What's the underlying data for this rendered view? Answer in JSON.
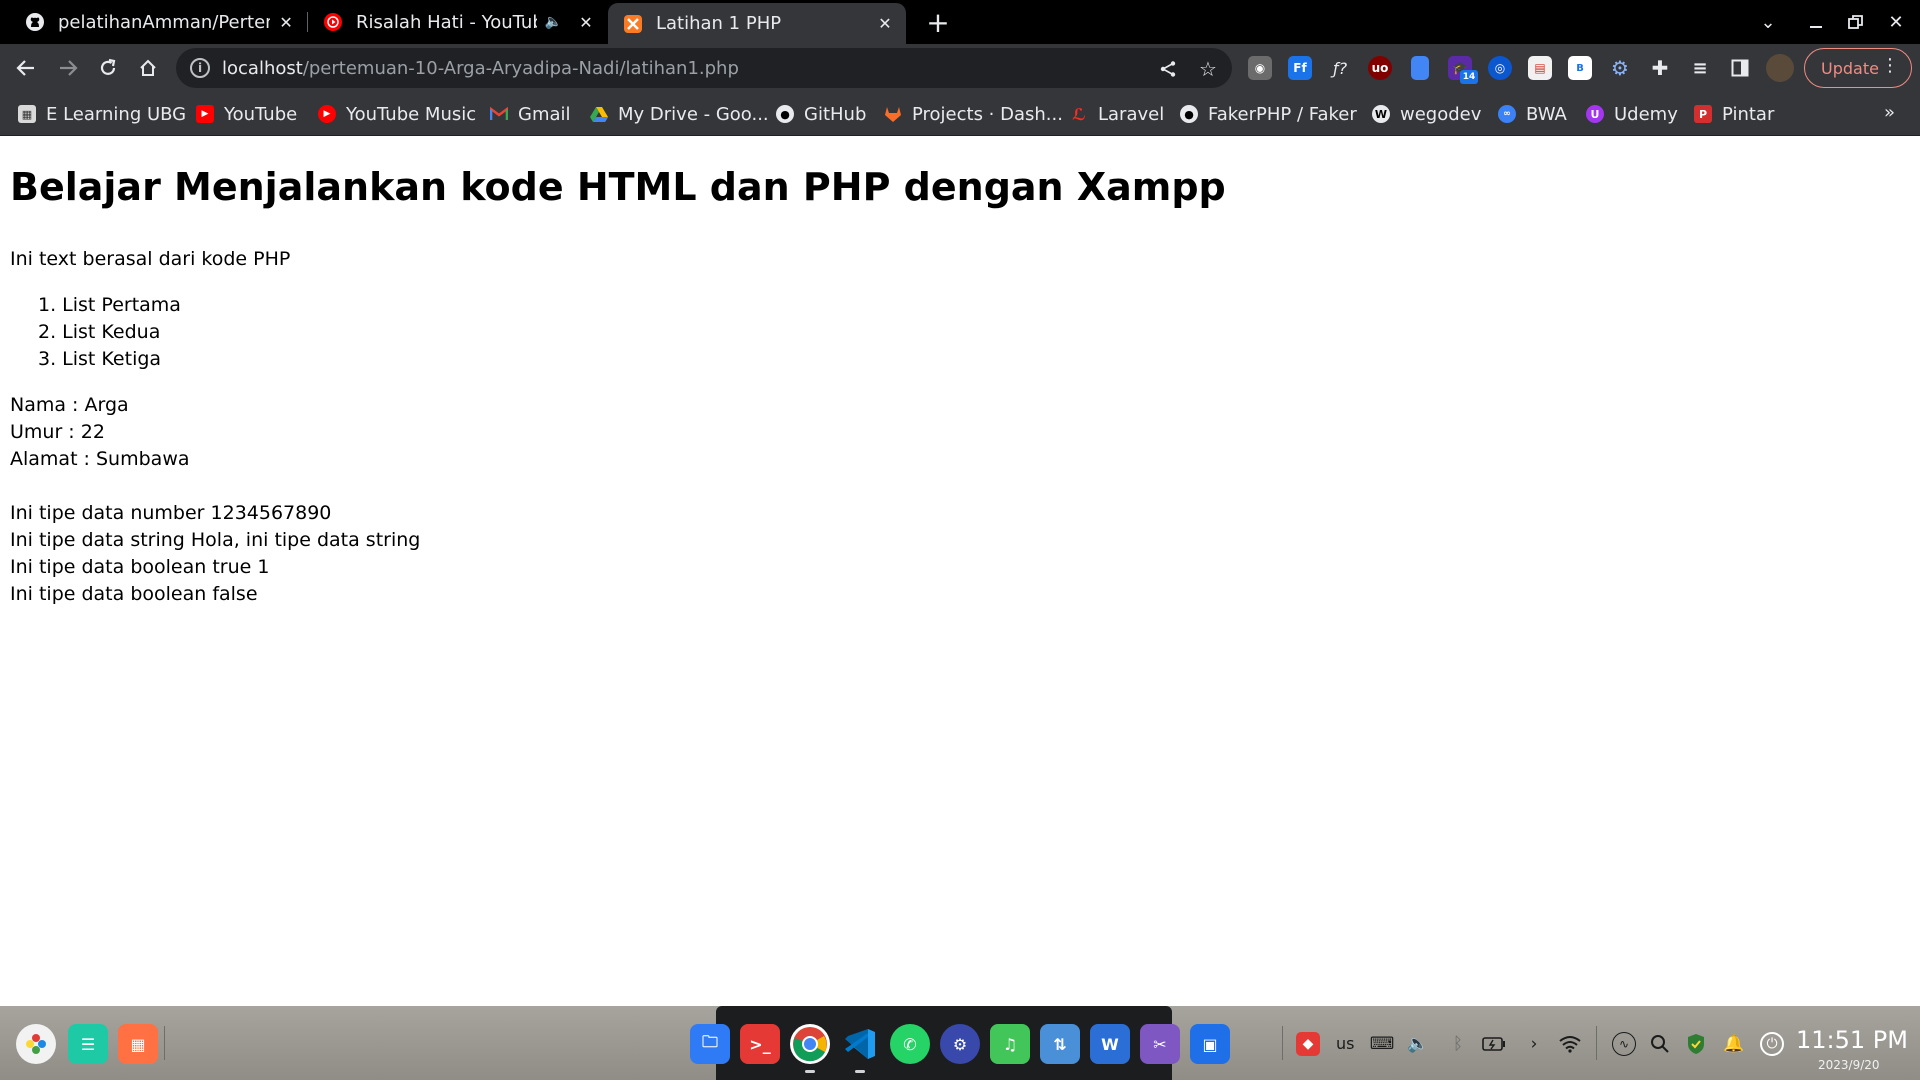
{
  "browser": {
    "tabs": [
      {
        "title": "pelatihanAmman/Pertemu",
        "icon": "github-icon",
        "active": false
      },
      {
        "title": "Risalah Hati - YouTube",
        "icon": "youtube-icon",
        "active": false,
        "audio": true
      },
      {
        "title": "Latihan 1 PHP",
        "icon": "xampp-icon",
        "active": true
      }
    ],
    "address": {
      "host": "localhost",
      "path": "/pertemuan-10-Arga-Aryadipa-Nadi/latihan1.php"
    },
    "update_label": "Update",
    "bookmarks": [
      {
        "label": "E Learning UBG",
        "icon": "elearning-icon",
        "color": "#d9d9d9"
      },
      {
        "label": "YouTube",
        "icon": "youtube-icon",
        "color": "#ff0000"
      },
      {
        "label": "YouTube Music",
        "icon": "youtube-music-icon",
        "color": "#ff0000"
      },
      {
        "label": "Gmail",
        "icon": "gmail-icon",
        "color": "#ea4335"
      },
      {
        "label": "My Drive - Goo...",
        "icon": "google-drive-icon",
        "color": "#34a853"
      },
      {
        "label": "GitHub",
        "icon": "github-icon",
        "color": "#ffffff"
      },
      {
        "label": "Projects · Dash...",
        "icon": "gitlab-icon",
        "color": "#fc6d26"
      },
      {
        "label": "Laravel",
        "icon": "laravel-icon",
        "color": "#ff2d20"
      },
      {
        "label": "FakerPHP / Faker",
        "icon": "faker-icon",
        "color": "#ffffff"
      },
      {
        "label": "wegodev",
        "icon": "wegodev-icon",
        "color": "#ffffff"
      },
      {
        "label": "BWA",
        "icon": "bwa-icon",
        "color": "#3b82f6"
      },
      {
        "label": "Udemy",
        "icon": "udemy-icon",
        "color": "#a435f0"
      },
      {
        "label": "Pintar",
        "icon": "pintar-icon",
        "color": "#d32f2f"
      }
    ],
    "extension_badge": "14"
  },
  "page": {
    "heading": "Belajar Menjalankan kode HTML dan PHP dengan Xampp",
    "intro": "Ini text berasal dari kode PHP",
    "list": [
      "1. List Pertama",
      "2. List Kedua",
      "3. List Ketiga"
    ],
    "profile": [
      "Nama : Arga",
      "Umur : 22",
      "Alamat : Sumbawa"
    ],
    "types": [
      "Ini tipe data number 1234567890",
      "Ini tipe data string Hola, ini tipe data string",
      "Ini tipe data boolean true 1",
      "Ini tipe data boolean false"
    ]
  },
  "taskbar": {
    "keyboard_layout": "us",
    "time": "11:51 PM",
    "date": "2023/9/20"
  },
  "colors": {
    "tabstrip": "#000000",
    "toolbar": "#35363a",
    "omnibox": "#202124",
    "update_accent": "#f28b82"
  }
}
